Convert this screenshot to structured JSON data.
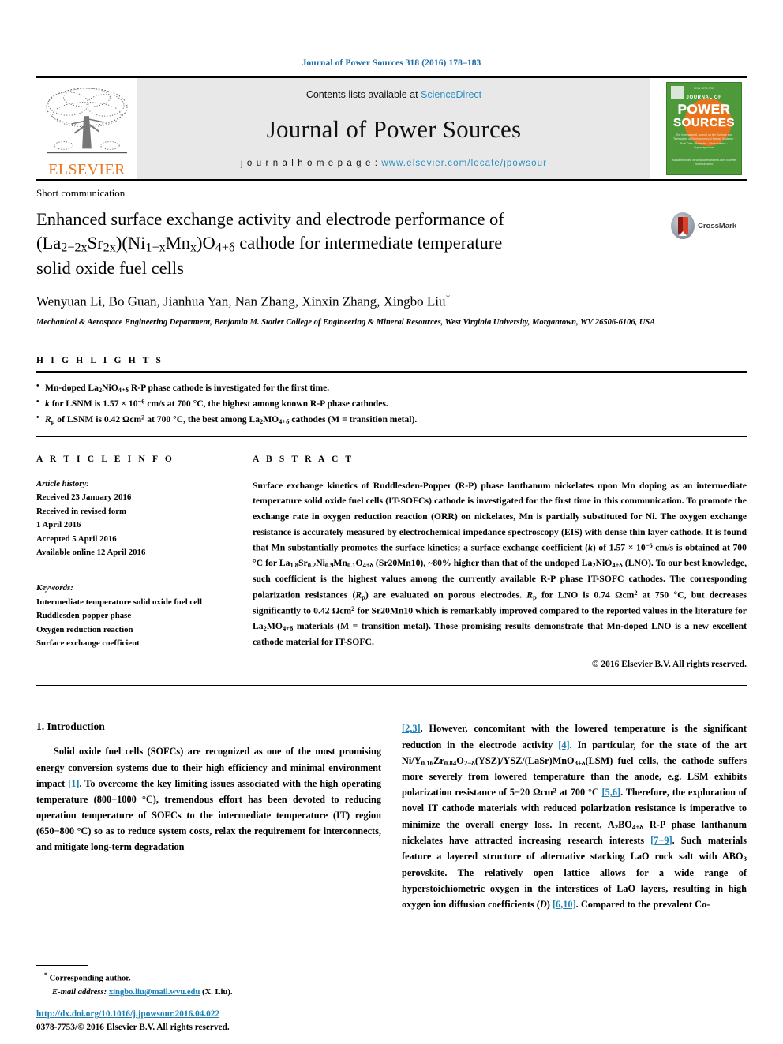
{
  "running_head": "Journal of Power Sources 318 (2016) 178–183",
  "masthead": {
    "contents_prefix": "Contents lists available at ",
    "sciencedirect": "ScienceDirect",
    "journal_name": "Journal of Power Sources",
    "homepage_prefix": "j o u r n a l   h o m e p a g e :  ",
    "homepage_url": "www.elsevier.com/locate/jpowsour",
    "publisher_logo_text": "ELSEVIER",
    "cover": {
      "top_text": "ISSN 0378-7753",
      "journal_of": "JOURNAL OF",
      "power": "POWER",
      "sources": "SOURCES",
      "subtitle": "The International Journal on the Science and Technology of Electrochemical Energy Systems · Fuel Cells · Batteries · Photovoltaics · Supercapacitors",
      "bottom_text": "Available online at www.sciencedirect.com\nElsevier ScienceDirect"
    }
  },
  "article": {
    "type": "Short communication",
    "title_line1": "Enhanced surface exchange activity and electrode performance of",
    "title_line2_pre": "(La",
    "title_formula_full": "(La2−2xSr2x)(Ni1−xMnx)O4+δ cathode for intermediate temperature",
    "title_line3": "solid oxide fuel cells",
    "crossmark_label": "CrossMark",
    "authors": "Wenyuan Li, Bo Guan, Jianhua Yan, Nan Zhang, Xinxin Zhang, Xingbo Liu",
    "affiliation": "Mechanical & Aerospace Engineering Department, Benjamin M. Statler College of Engineering & Mineral Resources, West Virginia University, Morgantown, WV 26506-6106, USA"
  },
  "highlights": {
    "heading": "H I G H L I G H T S",
    "items": [
      "Mn-doped La2NiO4+δ R-P phase cathode is investigated for the first time.",
      "k for LSNM is 1.57 × 10−6 cm/s at 700 °C, the highest among known R-P phase cathodes.",
      "Rp of LSNM is 0.42 Ωcm2 at 700 °C, the best among La2MO4+δ cathodes (M = transition metal)."
    ]
  },
  "article_info": {
    "heading": "A R T I C L E   I N F O",
    "history_label": "Article history:",
    "history": [
      "Received 23 January 2016",
      "Received in revised form",
      "1 April 2016",
      "Accepted 5 April 2016",
      "Available online 12 April 2016"
    ],
    "keywords_label": "Keywords:",
    "keywords": [
      "Intermediate temperature solid oxide fuel cell",
      "Ruddlesden-popper phase",
      "Oxygen reduction reaction",
      "Surface exchange coefficient"
    ]
  },
  "abstract": {
    "heading": "A B S T R A C T",
    "text": "Surface exchange kinetics of Ruddlesden-Popper (R-P) phase lanthanum nickelates upon Mn doping as an intermediate temperature solid oxide fuel cells (IT-SOFCs) cathode is investigated for the first time in this communication. To promote the exchange rate in oxygen reduction reaction (ORR) on nickelates, Mn is partially substituted for Ni. The oxygen exchange resistance is accurately measured by electrochemical impedance spectroscopy (EIS) with dense thin layer cathode. It is found that Mn substantially promotes the surface kinetics; a surface exchange coefficient (k) of 1.57 × 10−6 cm/s is obtained at 700 °C for La1.8Sr0.2Ni0.9Mn0.1O4+δ (Sr20Mn10), ~80% higher than that of the undoped La2NiO4+δ (LNO). To our best knowledge, such coefficient is the highest values among the currently available R-P phase IT-SOFC cathodes. The corresponding polarization resistances (Rp) are evaluated on porous electrodes. Rp for LNO is 0.74 Ωcm2 at 750 °C, but decreases significantly to 0.42 Ωcm2 for Sr20Mn10 which is remarkably improved compared to the reported values in the literature for La2MO4+δ materials (M = transition metal). Those promising results demonstrate that Mn-doped LNO is a new excellent cathode material for IT-SOFC.",
    "copyright": "© 2016 Elsevier B.V. All rights reserved."
  },
  "introduction": {
    "number_title": "1. Introduction",
    "left_paragraph": "Solid oxide fuel cells (SOFCs) are recognized as one of the most promising energy conversion systems due to their high efficiency and minimal environment impact [1]. To overcome the key limiting issues associated with the high operating temperature (800−1000 °C), tremendous effort has been devoted to reducing operation temperature of SOFCs to the intermediate temperature (IT) region (650−800 °C) so as to reduce system costs, relax the requirement for interconnects, and mitigate long-term degradation",
    "right_paragraph": "[2,3]. However, concomitant with the lowered temperature is the significant reduction in the electrode activity [4]. In particular, for the state of the art Ni/Y0.16Zr0.84O2−δ(YSZ)/YSZ/(LaSr)MnO3±δ(LSM) fuel cells, the cathode suffers more severely from lowered temperature than the anode, e.g. LSM exhibits polarization resistance of 5−20 Ωcm2 at 700 °C [5,6]. Therefore, the exploration of novel IT cathode materials with reduced polarization resistance is imperative to minimize the overall energy loss. In recent, A2BO4+δ R-P phase lanthanum nickelates have attracted increasing research interests [7−9]. Such materials feature a layered structure of alternative stacking LaO rock salt with ABO3 perovskite. The relatively open lattice allows for a wide range of hyperstoichiometric oxygen in the interstices of LaO layers, resulting in high oxygen ion diffusion coefficients (D) [6,10]. Compared to the prevalent Co-"
  },
  "footnote": {
    "corresponding": "Corresponding author.",
    "email_label": "E-mail address:",
    "email": "xingbo.liu@mail.wvu.edu",
    "email_suffix": " (X. Liu)."
  },
  "footer": {
    "doi": "http://dx.doi.org/10.1016/j.jpowsour.2016.04.022",
    "issn": "0378-7753/© 2016 Elsevier B.V. All rights reserved."
  },
  "colors": {
    "link": "#1a7fb5",
    "elsevier_orange": "#e87722",
    "cover_green": "#4e9a3a"
  }
}
